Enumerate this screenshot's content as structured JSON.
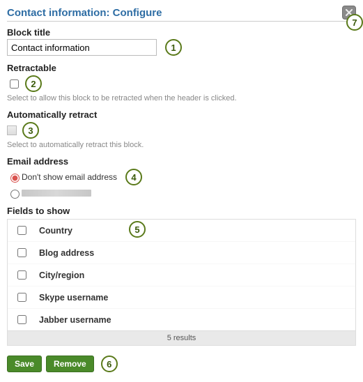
{
  "dialog": {
    "title": "Contact information: Configure"
  },
  "block_title": {
    "label": "Block title",
    "value": "Contact information"
  },
  "retractable": {
    "label": "Retractable",
    "checked": false,
    "hint": "Select to allow this block to be retracted when the header is clicked."
  },
  "auto_retract": {
    "label": "Automatically retract",
    "disabled": true,
    "hint": "Select to automatically retract this block."
  },
  "email": {
    "label": "Email address",
    "options": [
      {
        "label": "Don't show email address",
        "checked": true
      },
      {
        "label": "(hidden)",
        "checked": false,
        "redacted": true
      }
    ]
  },
  "fields": {
    "label": "Fields to show",
    "items": [
      {
        "label": "Country",
        "checked": false
      },
      {
        "label": "Blog address",
        "checked": false
      },
      {
        "label": "City/region",
        "checked": false
      },
      {
        "label": "Skype username",
        "checked": false
      },
      {
        "label": "Jabber username",
        "checked": false
      }
    ],
    "footer": "5 results"
  },
  "buttons": {
    "save": "Save",
    "remove": "Remove"
  },
  "callouts": [
    "1",
    "2",
    "3",
    "4",
    "5",
    "6",
    "7"
  ]
}
